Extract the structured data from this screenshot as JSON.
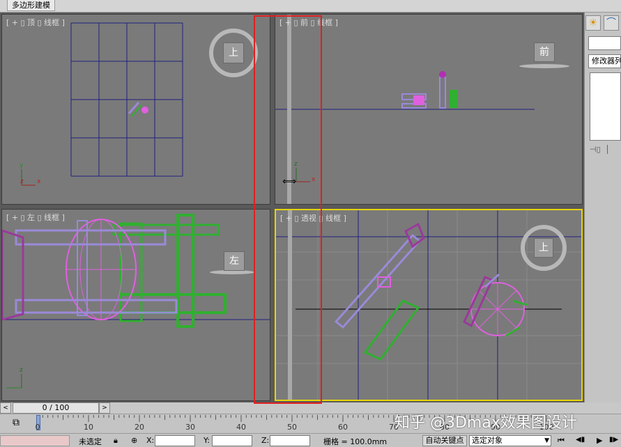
{
  "ribbon": {
    "tab_label": "多边形建模"
  },
  "viewports": {
    "top": {
      "label": "[ + ▯ 顶 ▯ 线框 ]",
      "cube_label": "上"
    },
    "front": {
      "label": "[ + ▯ 前 ▯ 线框 ]",
      "cube_label": "前"
    },
    "left": {
      "label": "[ + ▯ 左 ▯ 线框 ]",
      "cube_label": "左"
    },
    "perspective": {
      "label": "[ + ▯ 透视 ▯ 线框 ]",
      "cube_label": "上"
    }
  },
  "axis_labels": {
    "z": "z",
    "x": "x",
    "y": "y"
  },
  "command_panel": {
    "tab_create_icon": "sun-icon",
    "tab_modify_icon": "curve-icon",
    "modifier_list": "修改器列表",
    "pin_icon": "pin-icon"
  },
  "time_slider": {
    "label": "0 / 100",
    "prev": "<",
    "next": ">"
  },
  "timeline": {
    "ticks": [
      "0",
      "10",
      "20",
      "30",
      "40",
      "50",
      "60",
      "70",
      "80",
      "90",
      "100"
    ],
    "icon": "timeline-toggle-icon"
  },
  "status": {
    "selection": "未选定",
    "x_label": "X:",
    "y_label": "Y:",
    "z_label": "Z:",
    "grid": "栅格 = 100.0mm",
    "auto_key": "自动关键点",
    "selected_object": "选定对象"
  },
  "playback": {
    "first": "⏮",
    "prev_frame": "◀▮",
    "play": "▶",
    "next": "▮▶"
  },
  "watermark": "知乎 @3Dmax效果图设计",
  "colors": {
    "viewport_bg": "#7a7a7a",
    "active_border": "#e8d400",
    "grid_line": "#202080",
    "chair_purple": "#9a8ad8",
    "wheel_pink": "#e060e0",
    "leg_green": "#30b030",
    "annotation": "#e02020"
  }
}
